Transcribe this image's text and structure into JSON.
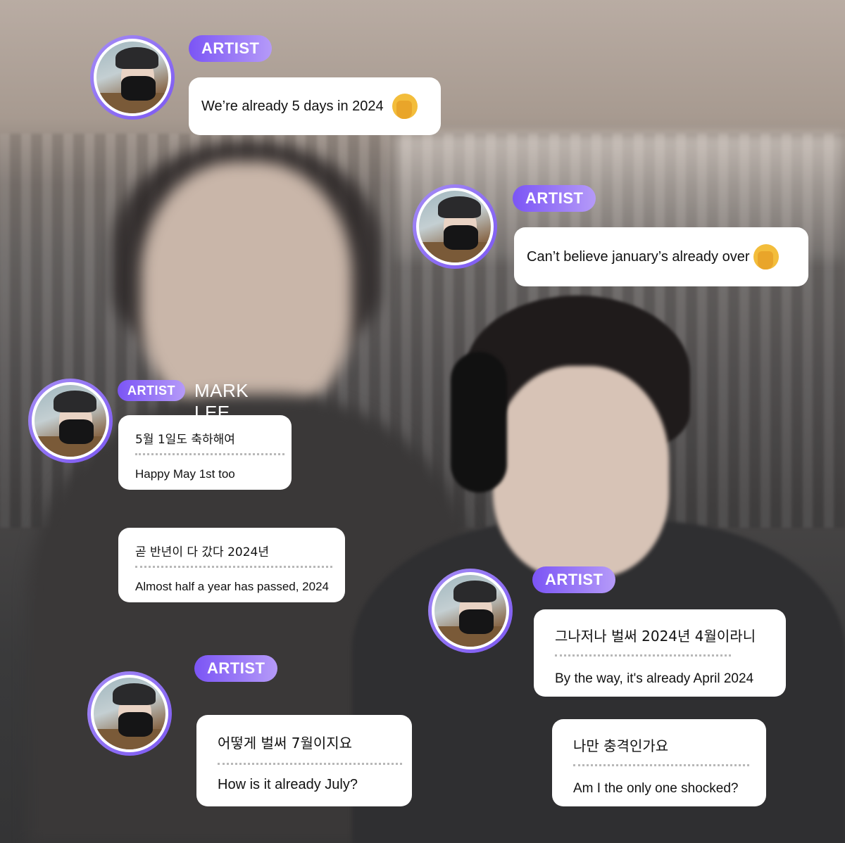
{
  "messages": [
    {
      "badge": "ARTIST",
      "name": "",
      "text": "We’re already 5 days in 2024",
      "emoji": "face-palm-emoji"
    },
    {
      "badge": "ARTIST",
      "name": "",
      "text": "Can’t believe january’s already over",
      "emoji": "face-palm-emoji"
    },
    {
      "badge": "ARTIST",
      "name": "MARK LEE",
      "korean": "5월 1일도 축하해여",
      "english": "Happy May 1st too"
    },
    {
      "badge": "",
      "name": "",
      "korean": "곧 반년이 다 갔다 2024년",
      "english": "Almost half a year has passed, 2024"
    },
    {
      "badge": "ARTIST",
      "name": "",
      "korean": "그나저나 벌써 2024년 4월이라니",
      "english": "By the way, it's already April 2024"
    },
    {
      "badge": "",
      "name": "",
      "korean": "나만 충격인가요",
      "english": "Am I the only one shocked?"
    },
    {
      "badge": "ARTIST",
      "name": "",
      "korean": "어떻게 벌써 7월이지요",
      "english": "How is it already July?"
    }
  ],
  "colors": {
    "badge_start": "#7b55f5",
    "badge_end": "#b59af8",
    "avatar_ring": "#8f6ff4",
    "bubble": "#ffffff"
  },
  "icons": {
    "emoji": "face-palm-emoji",
    "avatar": "artist-avatar"
  }
}
